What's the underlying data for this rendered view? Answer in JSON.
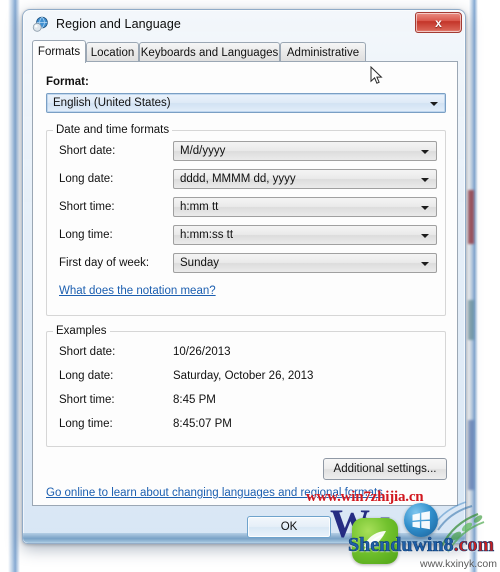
{
  "window": {
    "title": "Region and Language",
    "icon": "globe-icon",
    "close_label": "x"
  },
  "tabs": [
    {
      "label": "Formats",
      "selected": true
    },
    {
      "label": "Location",
      "selected": false
    },
    {
      "label": "Keyboards and Languages",
      "selected": false
    },
    {
      "label": "Administrative",
      "selected": false
    }
  ],
  "format_section": {
    "label": "Format:",
    "value": "English (United States)"
  },
  "date_time_group": {
    "title": "Date and time formats",
    "rows": [
      {
        "label": "Short date:",
        "value": "M/d/yyyy"
      },
      {
        "label": "Long date:",
        "value": "dddd, MMMM dd, yyyy"
      },
      {
        "label": "Short time:",
        "value": "h:mm tt"
      },
      {
        "label": "Long time:",
        "value": "h:mm:ss tt"
      },
      {
        "label": "First day of week:",
        "value": "Sunday"
      }
    ],
    "notation_link": "What does the notation mean?"
  },
  "examples_group": {
    "title": "Examples",
    "rows": [
      {
        "label": "Short date:",
        "value": "10/26/2013"
      },
      {
        "label": "Long date:",
        "value": "Saturday, October 26, 2013"
      },
      {
        "label": "Short time:",
        "value": "8:45 PM"
      },
      {
        "label": "Long time:",
        "value": "8:45:07 PM"
      }
    ]
  },
  "footer": {
    "additional_settings_label": "Additional settings...",
    "go_online_link": "Go online to learn about changing languages and regional formats",
    "ok_label": "OK"
  },
  "watermarks": {
    "win7zhijia": "www.win7zhijia.cn",
    "w_logo": "W",
    "win7_faint": "in7",
    "shenduwin8_blue": "Shenduwin8",
    "shenduwin8_red": ".com",
    "kxinyk": "www.kxinyk.com"
  },
  "colors": {
    "link": "#1c5fb0",
    "close_red": "#c33428",
    "watermark_red": "#d1181f",
    "watermark_blue": "#1f5fa8"
  }
}
